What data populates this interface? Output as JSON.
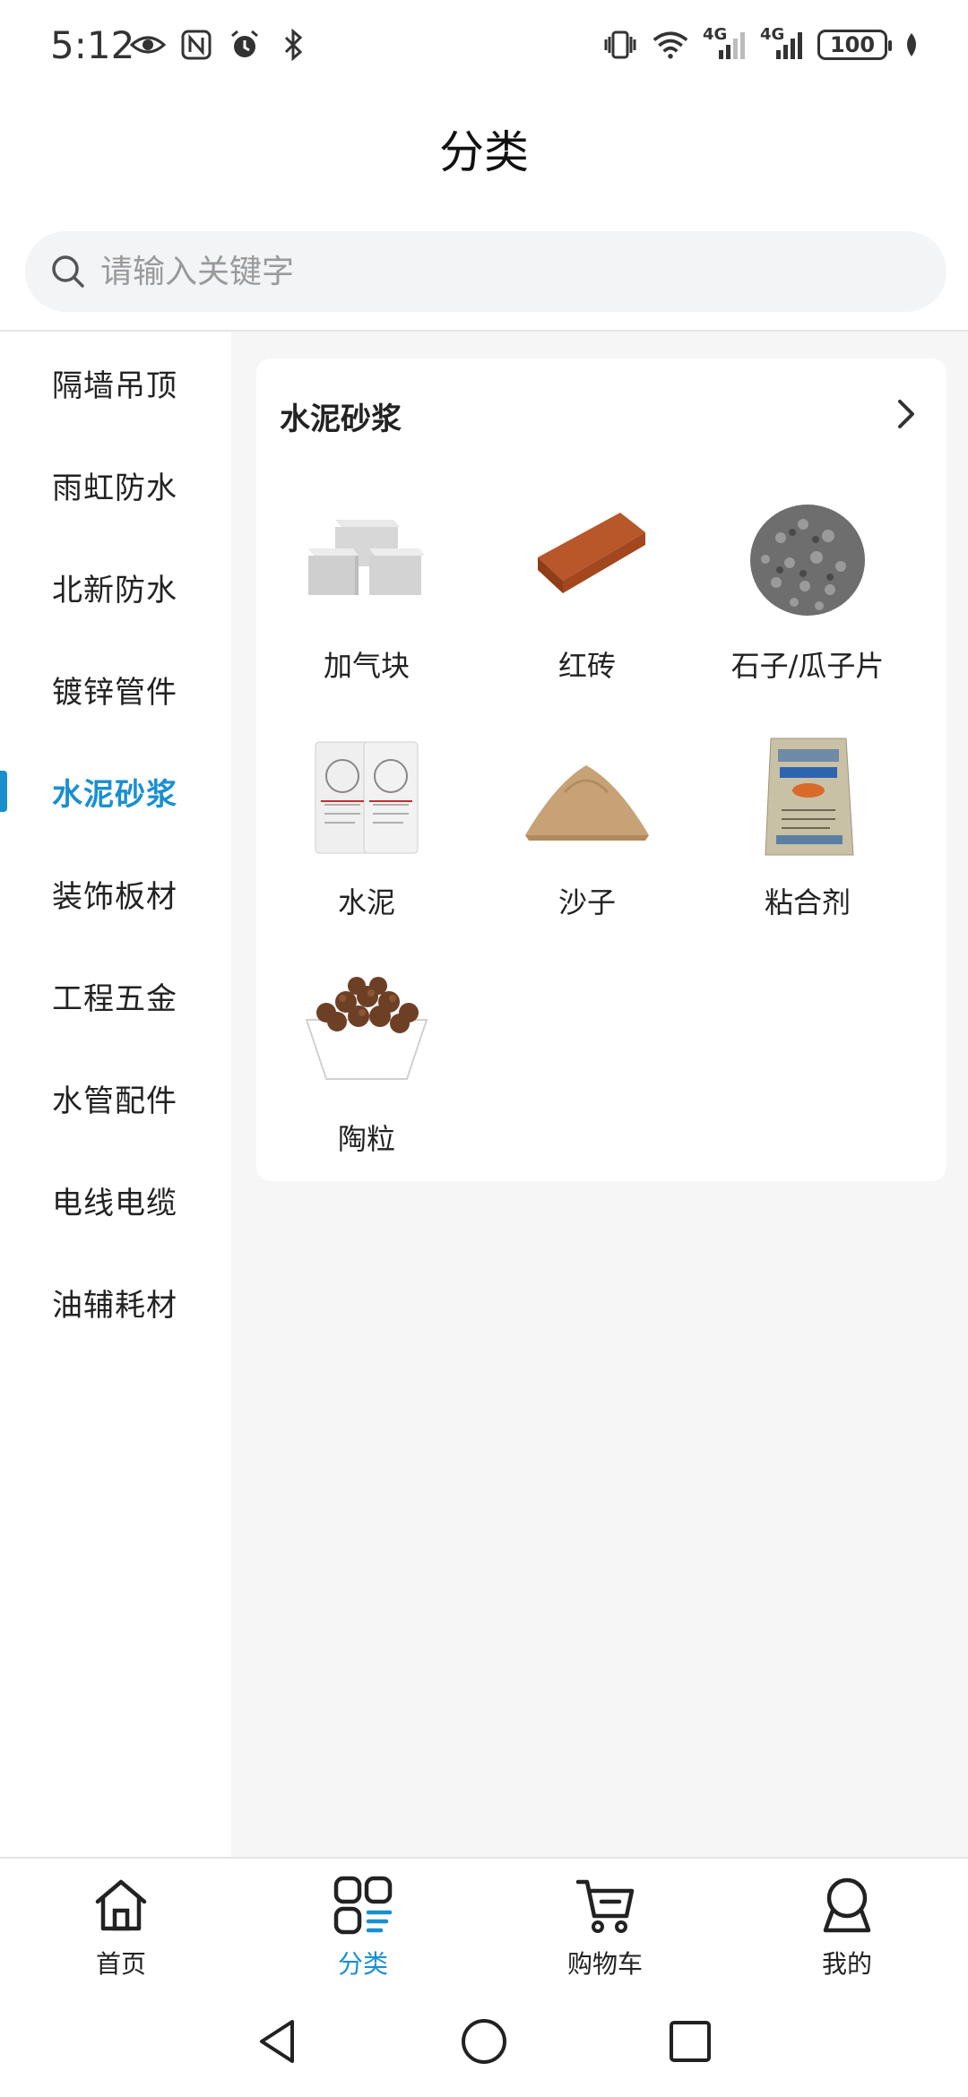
{
  "status_bar": {
    "time": "5:12",
    "battery": "100",
    "net_1": "4G",
    "net_2": "4G"
  },
  "header": {
    "title": "分类"
  },
  "search": {
    "placeholder": "请输入关键字",
    "value": ""
  },
  "sidebar": {
    "items": [
      {
        "label": "隔墙吊顶"
      },
      {
        "label": "雨虹防水"
      },
      {
        "label": "北新防水"
      },
      {
        "label": "镀锌管件"
      },
      {
        "label": "水泥砂浆"
      },
      {
        "label": "装饰板材"
      },
      {
        "label": "工程五金"
      },
      {
        "label": "水管配件"
      },
      {
        "label": "电线电缆"
      },
      {
        "label": "油辅耗材"
      }
    ],
    "active_index": 4
  },
  "main": {
    "section_title": "水泥砂浆",
    "products": [
      {
        "name": "加气块",
        "icon": "aerated-block-image"
      },
      {
        "name": "红砖",
        "icon": "red-brick-image"
      },
      {
        "name": "石子/瓜子片",
        "icon": "gravel-image"
      },
      {
        "name": "水泥",
        "icon": "cement-bag-image"
      },
      {
        "name": "沙子",
        "icon": "sand-pile-image"
      },
      {
        "name": "粘合剂",
        "icon": "adhesive-bag-image"
      },
      {
        "name": "陶粒",
        "icon": "ceramsite-bowl-image"
      }
    ]
  },
  "tabbar": {
    "tabs": [
      {
        "label": "首页",
        "icon": "home-icon"
      },
      {
        "label": "分类",
        "icon": "category-icon"
      },
      {
        "label": "购物车",
        "icon": "cart-icon"
      },
      {
        "label": "我的",
        "icon": "profile-icon"
      }
    ],
    "active_index": 1
  },
  "colors": {
    "accent": "#1a8fd0",
    "background": "#f6f6f6",
    "text": "#222222"
  }
}
